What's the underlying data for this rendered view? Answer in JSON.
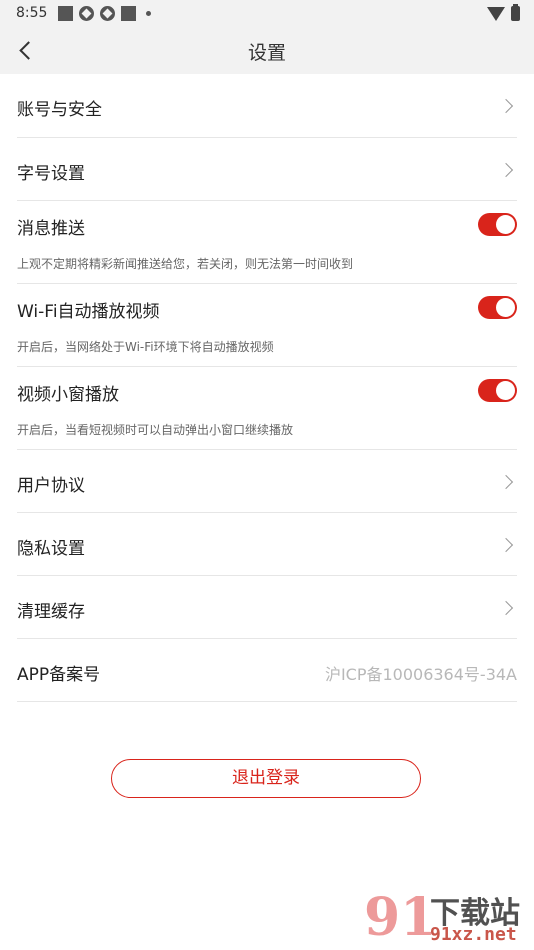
{
  "status_bar": {
    "time": "8:55"
  },
  "header": {
    "title": "设置"
  },
  "items": {
    "account": {
      "label": "账号与安全"
    },
    "font_size": {
      "label": "字号设置"
    },
    "push": {
      "label": "消息推送",
      "desc": "上观不定期将精彩新闻推送给您，若关闭，则无法第一时间收到",
      "enabled": true
    },
    "wifi_autoplay": {
      "label": "Wi-Fi自动播放视频",
      "desc": "开启后，当网络处于Wi-Fi环境下将自动播放视频",
      "enabled": true
    },
    "mini_window": {
      "label": "视频小窗播放",
      "desc": "开启后，当看短视频时可以自动弹出小窗口继续播放",
      "enabled": true
    },
    "agreement": {
      "label": "用户协议"
    },
    "privacy": {
      "label": "隐私设置"
    },
    "cache": {
      "label": "清理缓存"
    },
    "icp": {
      "label": "APP备案号",
      "value": "沪ICP备10006364号-34A"
    }
  },
  "logout": {
    "label": "退出登录"
  },
  "watermark": {
    "number": "91",
    "text": "下载站",
    "url": "91xz.net"
  },
  "colors": {
    "accent": "#d9241b",
    "header_bg": "#f2f2f2"
  }
}
